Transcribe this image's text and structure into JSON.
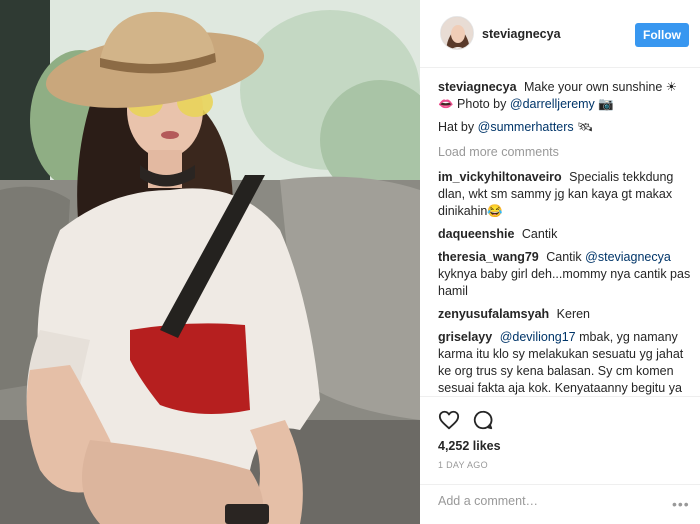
{
  "post": {
    "username": "steviagnecya",
    "follow_label": "Follow"
  },
  "caption": {
    "username": "steviagnecya",
    "text_1": "Make your own sunshine ☀",
    "text_2_prefix": "👄 Photo by",
    "photographer": "@darrelljeremy",
    "text_2_suffix": "📷",
    "hat_prefix": "Hat by",
    "hat_mention": "@summerhatters",
    "hat_suffix": "🛰"
  },
  "load_more_label": "Load more comments",
  "comments": [
    {
      "user": "im_vickyhiltonaveiro",
      "text": "Specialis tekkdung dlan, wkt sm sammy jg kan kaya gt makax dinikahin😂"
    },
    {
      "user": "daqueenshie",
      "text": "Cantik"
    },
    {
      "user": "theresia_wang79",
      "text_prefix": "Cantik",
      "mention": "@steviagnecya",
      "text": "kyknya baby girl deh...mommy nya cantik pas hamil"
    },
    {
      "user": "zenyusufalamsyah",
      "text": "Keren"
    },
    {
      "user": "griselayy",
      "mention": "@deviliong17",
      "text": "mbak, yg namany karma itu klo sy melakukan sesuatu yg jahat ke org trus sy kena balasan. Sy cm komen sesuai fakta aja kok. Kenyataanny begitu ya sy blg begitu. Is that wrong ? Will I get a"
    }
  ],
  "actions": {
    "like_icon": "heart-icon",
    "comment_icon": "speech-bubble-icon"
  },
  "likes": "4,252 likes",
  "timestamp": "1 DAY AGO",
  "add_comment_placeholder": "Add a comment…",
  "more_label": "•••",
  "colors": {
    "follow_button": "#3897f0",
    "mention": "#003569",
    "muted": "#999999",
    "border": "#efefef"
  }
}
